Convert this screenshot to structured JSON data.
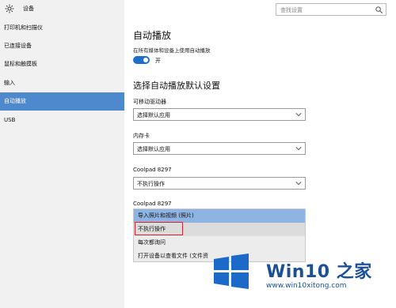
{
  "window": {
    "title": "设备"
  },
  "search": {
    "placeholder": "查找设置"
  },
  "sidebar": {
    "items": [
      {
        "label": "打印机和扫描仪",
        "active": false
      },
      {
        "label": "已连接设备",
        "active": false
      },
      {
        "label": "鼠标和触摸板",
        "active": false
      },
      {
        "label": "输入",
        "active": false
      },
      {
        "label": "自动播放",
        "active": true
      },
      {
        "label": "USB",
        "active": false
      }
    ]
  },
  "main": {
    "title": "自动播放",
    "toggle_caption": "在所有媒体和设备上使用自动播放",
    "toggle_state_label": "开",
    "toggle_on": true,
    "section_title": "选择自动播放默认设置",
    "fields": [
      {
        "label": "可移动驱动器",
        "value": "选择默认应用"
      },
      {
        "label": "内存卡",
        "value": "选择默认应用"
      },
      {
        "label": "Coolpad 8297",
        "value": "不执行操作"
      },
      {
        "label": "Coolpad 8297",
        "value": ""
      }
    ],
    "dropdown_options": [
      "导入照片和视频 (照片)",
      "不执行操作",
      "每次都询问",
      "打开设备以查看文件 (文件资"
    ],
    "dropdown_highlighted_index": 0,
    "dropdown_selected_index": 1
  },
  "watermark": {
    "brand": "Win10 之家",
    "url": "www.win10xitong.com"
  },
  "colors": {
    "accent": "#4d89cc",
    "toggle_on": "#1f6fc8",
    "highlight": "#8db4e2",
    "annotation_red": "#d2262a",
    "watermark_blue": "#1b4f96"
  }
}
